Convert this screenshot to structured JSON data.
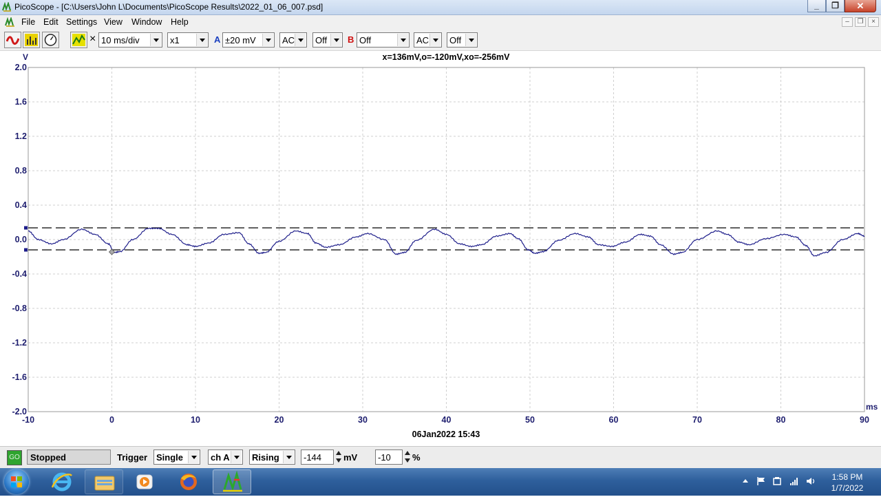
{
  "window": {
    "title": "PicoScope - [C:\\Users\\John L\\Documents\\PicoScope Results\\2022_01_06_007.psd]",
    "controls": [
      "minimize-icon",
      "restore-icon",
      "close-icon"
    ]
  },
  "menu": {
    "items": [
      "File",
      "Edit",
      "Settings",
      "View",
      "Window",
      "Help"
    ]
  },
  "toolbar": {
    "mode_icons": [
      "scope-mode-icon",
      "spectrum-mode-icon",
      "meter-mode-icon",
      "signal-generator-icon"
    ],
    "close_glyph": "×",
    "timebase": "10 ms/div",
    "zoom": "x1",
    "channel_a": {
      "label": "A",
      "range": "±20 mV",
      "coupling": "AC",
      "filter": "Off",
      "color": "#1a3fbf"
    },
    "channel_b": {
      "label": "B",
      "range": "Off",
      "coupling": "AC",
      "filter": "Off",
      "color": "#d01010"
    }
  },
  "plot": {
    "y_unit": "V",
    "x_unit": "ms",
    "measurement": "x=136mV,o=-120mV,xo=-256mV",
    "timestamp": "06Jan2022  15:43",
    "trace_color": "#1d1d8a",
    "axis_label_color": "#1d1d6e",
    "cursor_upper": 0.136,
    "cursor_lower": -0.12
  },
  "chart_data": {
    "type": "line",
    "title": "",
    "xlabel": "ms",
    "ylabel": "V",
    "xlim": [
      -10,
      90
    ],
    "ylim": [
      -2.0,
      2.0
    ],
    "grid": true,
    "x_ticks": [
      "-10",
      "0",
      "10",
      "20",
      "30",
      "40",
      "50",
      "60",
      "70",
      "80",
      "90"
    ],
    "y_ticks": [
      "2.0",
      "1.6",
      "1.2",
      "0.8",
      "0.4",
      "0.0",
      "-0.4",
      "-0.8",
      "-1.2",
      "-1.6",
      "-2.0"
    ],
    "series": [
      {
        "x": [
          -10,
          -8.8,
          -7.2,
          -5.8,
          -3.6,
          -2.0,
          -0.4,
          0.3,
          1.0,
          2.5,
          4.4,
          5.6,
          7.2,
          9.0,
          10.0,
          11.6,
          13.4,
          15.2,
          16.4,
          17.6,
          18.4,
          20.0,
          22.0,
          23.4,
          24.4,
          25.6,
          27.2,
          29.2,
          30.6,
          32.6,
          34.0,
          35.0,
          36.4,
          38.6,
          40.0,
          41.6,
          43.0,
          44.2,
          46.0,
          47.6,
          48.6,
          49.8,
          50.6,
          51.6,
          53.4,
          55.4,
          57.0,
          58.2,
          59.8,
          61.4,
          63.2,
          64.4,
          65.6,
          67.2,
          68.2,
          70.0,
          72.4,
          73.6,
          75.0,
          76.2,
          78.2,
          80.4,
          81.8,
          83.0,
          84.0,
          85.4,
          87.4,
          89.2,
          90.0
        ],
        "y": [
          0.1,
          0.0,
          -0.05,
          0.0,
          0.12,
          0.06,
          -0.05,
          -0.15,
          -0.14,
          0.0,
          0.13,
          0.13,
          0.06,
          -0.06,
          -0.08,
          -0.04,
          0.06,
          0.08,
          -0.05,
          -0.16,
          -0.15,
          -0.02,
          0.1,
          0.07,
          -0.04,
          -0.09,
          -0.06,
          0.03,
          0.07,
          0.0,
          -0.17,
          -0.15,
          -0.01,
          0.12,
          0.06,
          -0.05,
          -0.08,
          -0.06,
          0.04,
          0.07,
          0.01,
          -0.12,
          -0.16,
          -0.14,
          -0.01,
          0.07,
          0.03,
          -0.06,
          -0.08,
          -0.03,
          0.06,
          0.04,
          -0.06,
          -0.17,
          -0.15,
          0.0,
          0.1,
          0.06,
          -0.03,
          -0.06,
          0.01,
          0.06,
          0.03,
          -0.07,
          -0.19,
          -0.15,
          0.0,
          0.07,
          0.04
        ]
      }
    ]
  },
  "status": {
    "go_label": "GO",
    "state": "Stopped",
    "trigger_label": "Trigger",
    "trigger_mode": "Single",
    "trigger_channel": "ch A",
    "trigger_edge": "Rising",
    "trigger_level": "-144",
    "trigger_level_unit": "mV",
    "pre_trigger": "-10",
    "pre_trigger_unit": "%"
  },
  "taskbar": {
    "apps": [
      "internet-explorer-icon",
      "file-explorer-icon",
      "media-player-icon",
      "firefox-icon",
      "picoscope-icon"
    ],
    "tray": [
      "show-hidden-icons-icon",
      "action-center-flag-icon",
      "network-adapter-icon",
      "signal-bars-icon",
      "volume-icon"
    ],
    "time": "1:58 PM",
    "date": "1/7/2022"
  }
}
